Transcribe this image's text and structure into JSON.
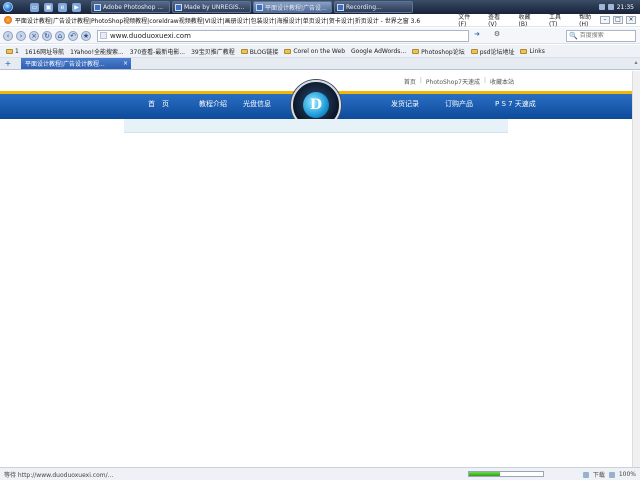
{
  "taskbar": {
    "tasks": [
      {
        "label": "Adobe Photoshop ...",
        "active": false
      },
      {
        "label": "Made by UNREGIS...",
        "active": false
      },
      {
        "label": "平面设计教程|广告设...",
        "active": true
      },
      {
        "label": "Recording...",
        "active": false
      }
    ],
    "clock": "21:35"
  },
  "titlebar": {
    "title": "平面设计教程|广告设计教程|PhotoShop视频教程|coreldraw视频教程|VI设计|画册设计|包装设计|海报设计|单页设计|贺卡设计|折页设计 - 世界之窗 3.6",
    "menus": [
      "文件(F)",
      "查看(V)",
      "收藏(B)",
      "工具(T)",
      "帮助(H)"
    ]
  },
  "navbar": {
    "url": "www.duoduoxuexi.com",
    "search_placeholder": "百度搜索"
  },
  "bookmarks": [
    {
      "label": "1",
      "kind": "folder"
    },
    {
      "label": "1616网址导航",
      "kind": "page"
    },
    {
      "label": "1Yahoo!全能搜索...",
      "kind": "page"
    },
    {
      "label": "370查看-最新电影...",
      "kind": "page"
    },
    {
      "label": "39宝贝推广教程",
      "kind": "page"
    },
    {
      "label": "BLOG链接",
      "kind": "folder"
    },
    {
      "label": "Corel on the Web",
      "kind": "folder"
    },
    {
      "label": "Google AdWords...",
      "kind": "page"
    },
    {
      "label": "Photoshop论坛",
      "kind": "folder"
    },
    {
      "label": "psd论坛地址",
      "kind": "folder"
    },
    {
      "label": "Links",
      "kind": "folder"
    }
  ],
  "tab": {
    "label": "平面设计教程|广告设计教程..."
  },
  "site": {
    "toplinks": [
      "首页",
      "PhotoShop7天速成",
      "收藏本站"
    ],
    "nav": [
      "首　页",
      "教程介绍",
      "光盘信息",
      "发货记录",
      "订购产品",
      "P S 7 天速成"
    ],
    "logo_letter": "D"
  },
  "status": {
    "text": "等待 http://www.duoduoxuexi.com/...",
    "progress": 0.42,
    "download_label": "下载",
    "zoom": "100%"
  },
  "colors": {
    "nav_band": "#1560b5",
    "nav_top_stripe": "#f5b800",
    "tab_active": "#3d70c2"
  }
}
